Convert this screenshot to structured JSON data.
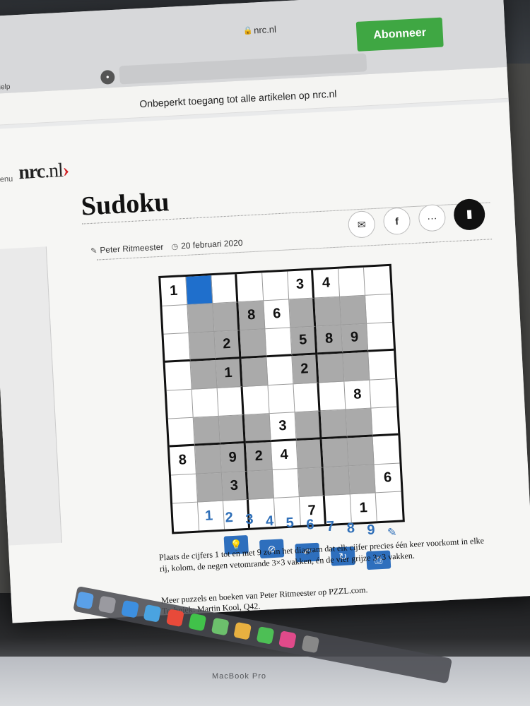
{
  "browser": {
    "host": "nrc.nl",
    "menu_help": "Help",
    "lock_icon": "lock-icon"
  },
  "paywall": {
    "text": "Onbeperkt toegang tot alle artikelen op nrc.nl",
    "subscribe_label": "Abonneer"
  },
  "site": {
    "menu_label": "Menu",
    "logo_name": "nrc",
    "logo_tld": ".nl"
  },
  "article": {
    "title": "Sudoku",
    "author": "Peter Ritmeester",
    "date": "20 februari 2020",
    "share_icons": [
      "mail-icon",
      "facebook-icon",
      "more-icon",
      "bookmark-icon"
    ]
  },
  "sudoku": {
    "rows": [
      [
        "1",
        "",
        "",
        "",
        "",
        "3",
        "4",
        "",
        ""
      ],
      [
        "",
        "",
        "",
        "8",
        "6",
        "",
        "",
        "",
        ""
      ],
      [
        "",
        "",
        "2",
        "",
        "",
        "5",
        "8",
        "9",
        ""
      ],
      [
        "",
        "",
        "1",
        "",
        "",
        "2",
        "",
        "",
        ""
      ],
      [
        "",
        "",
        "",
        "",
        "",
        "",
        "",
        "8",
        ""
      ],
      [
        "",
        "",
        "",
        "",
        "3",
        "",
        "",
        "",
        ""
      ],
      [
        "8",
        "",
        "9",
        "2",
        "4",
        "",
        "",
        "",
        ""
      ],
      [
        "",
        "",
        "3",
        "",
        "",
        "",
        "",
        "",
        "6"
      ],
      [
        "",
        "",
        "",
        "",
        "",
        "7",
        "",
        "1",
        ""
      ]
    ],
    "selected_cell": [
      0,
      1
    ],
    "digits": [
      "1",
      "2",
      "3",
      "4",
      "5",
      "6",
      "7",
      "8",
      "9"
    ],
    "tools": [
      "hint-icon",
      "hide-icon",
      "undo-icon",
      "redo-icon",
      "print-icon"
    ],
    "digit_color": "#2f6fb8",
    "selected_color": "#1f6fcc"
  },
  "instructions": "Plaats de cijfers 1 tot en met 9 zo in het diagram dat elk cijfer precies één keer voorkomt in elke rij, kolom, de negen vetomrande 3×3 vakken, én de vier grijze 3×3 vakken.",
  "more_puzzles": "Meer puzzels en boeken van Peter Ritmeester op PZZL.com.",
  "technique": "Techniek: Martin Kool, Q42.",
  "laptop_brand": "MacBook Pro",
  "colors": {
    "subscribe": "#3fa743",
    "logo_accent": "#d2262a"
  }
}
